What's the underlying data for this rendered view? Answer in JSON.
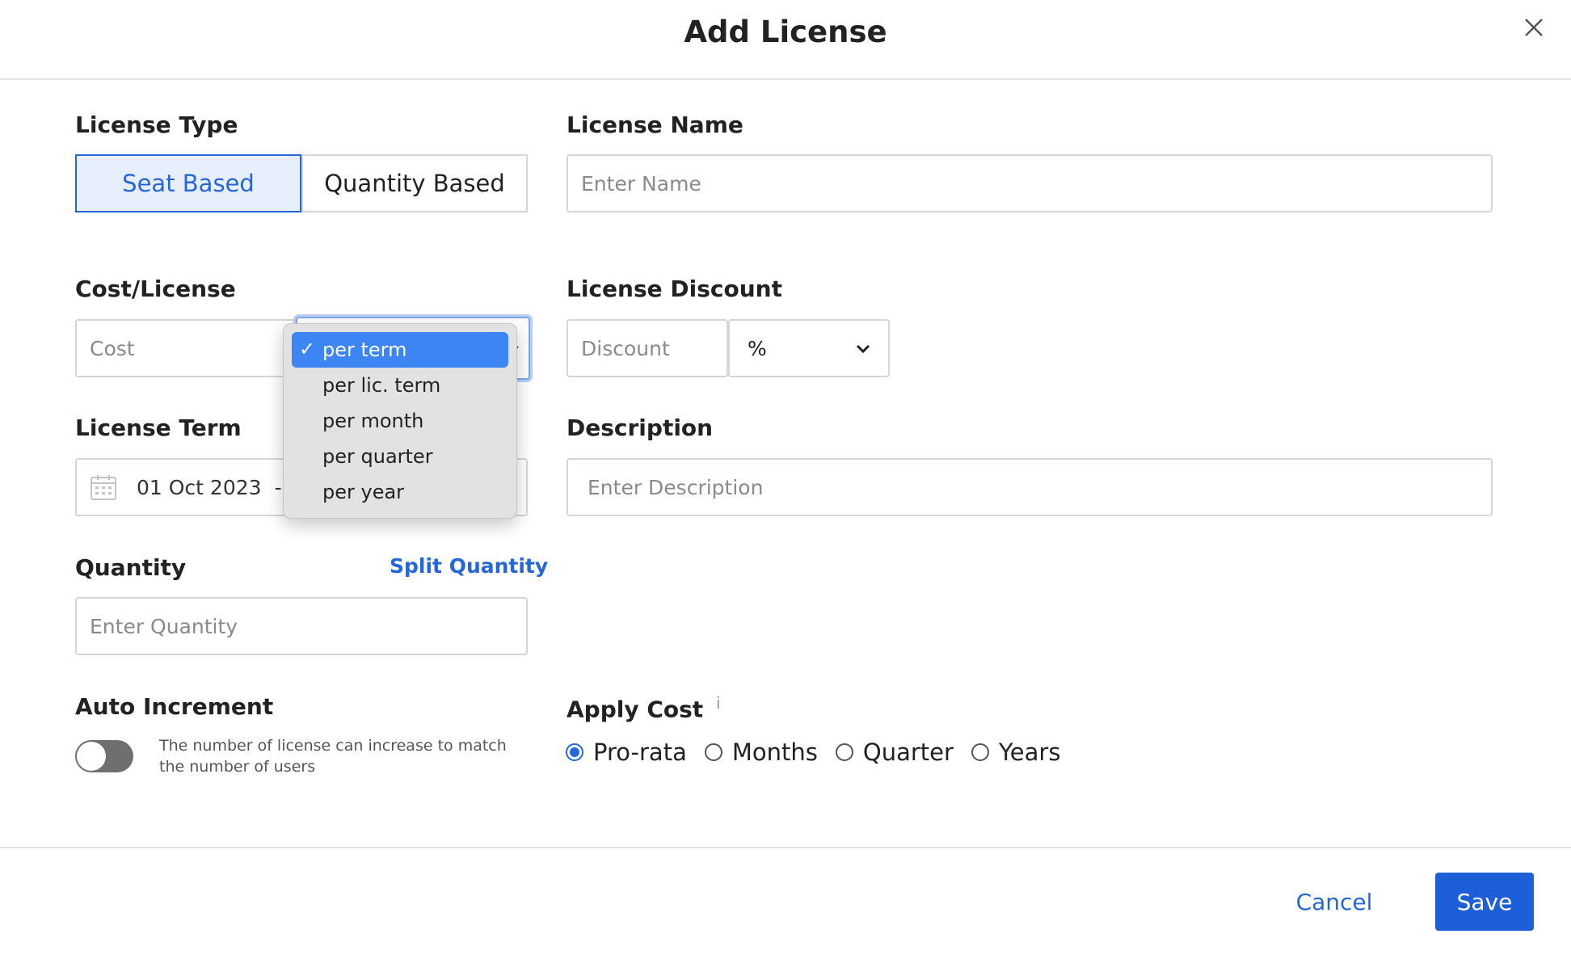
{
  "dialog": {
    "title": "Add License",
    "close_icon": "close-icon"
  },
  "license_type": {
    "label": "License Type",
    "options": [
      "Seat Based",
      "Quantity Based"
    ],
    "selected": "Seat Based"
  },
  "license_name": {
    "label": "License Name",
    "placeholder": "Enter Name"
  },
  "cost_license": {
    "label": "Cost/License",
    "cost_placeholder": "Cost",
    "period_options": [
      "per term",
      "per lic. term",
      "per month",
      "per quarter",
      "per year"
    ],
    "period_selected": "per term"
  },
  "license_discount": {
    "label": "License Discount",
    "placeholder": "Discount",
    "unit_selected": "%"
  },
  "license_term": {
    "label": "License Term",
    "start_date": "01 Oct 2023",
    "separator": "-"
  },
  "description": {
    "label": "Description",
    "placeholder": "Enter Description"
  },
  "quantity": {
    "label": "Quantity",
    "placeholder": "Enter Quantity",
    "split_link": "Split Quantity"
  },
  "auto_increment": {
    "label": "Auto Increment",
    "enabled": false,
    "help_text": "The number of license can increase to match the number of users"
  },
  "apply_cost": {
    "label": "Apply Cost",
    "info_mark": "i",
    "options": [
      "Pro-rata",
      "Months",
      "Quarter",
      "Years"
    ],
    "selected": "Pro-rata"
  },
  "footer": {
    "cancel_label": "Cancel",
    "save_label": "Save"
  },
  "colors": {
    "accent": "#2566d8",
    "save_button": "#1d5fd8",
    "dropdown_highlight": "#3d84f5"
  }
}
